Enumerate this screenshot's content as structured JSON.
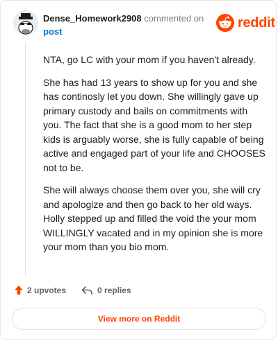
{
  "header": {
    "username": "Dense_Homework2908",
    "action_text": "commented on",
    "post_link": "post"
  },
  "brand": {
    "wordmark": "reddit",
    "icon": "reddit-snoo-icon",
    "color": "#ff4500"
  },
  "comment": {
    "paragraphs": [
      "NTA, go LC with your mom if you haven't already.",
      "She has had 13 years to show up for you and she has continosly let you down. She willingly gave up primary custody and bails on commitments with you. The fact that she is a good mom to her step kids is arguably worse, she is fully capable of being active and engaged part of your life and CHOOSES not to be.",
      "She will always choose them over you, she will cry and apologize and then go back to her old ways. Holly stepped up and filled the void the your mom WILLINGLY vacated and in my opinion she is more your mom than you bio mom."
    ]
  },
  "actions": {
    "upvotes": "2 upvotes",
    "upvote_icon": "upvote-arrow-icon",
    "upvote_color": "#ff4500",
    "replies": "0 replies",
    "reply_icon": "reply-arrow-icon"
  },
  "footer": {
    "view_more": "View more on Reddit"
  }
}
